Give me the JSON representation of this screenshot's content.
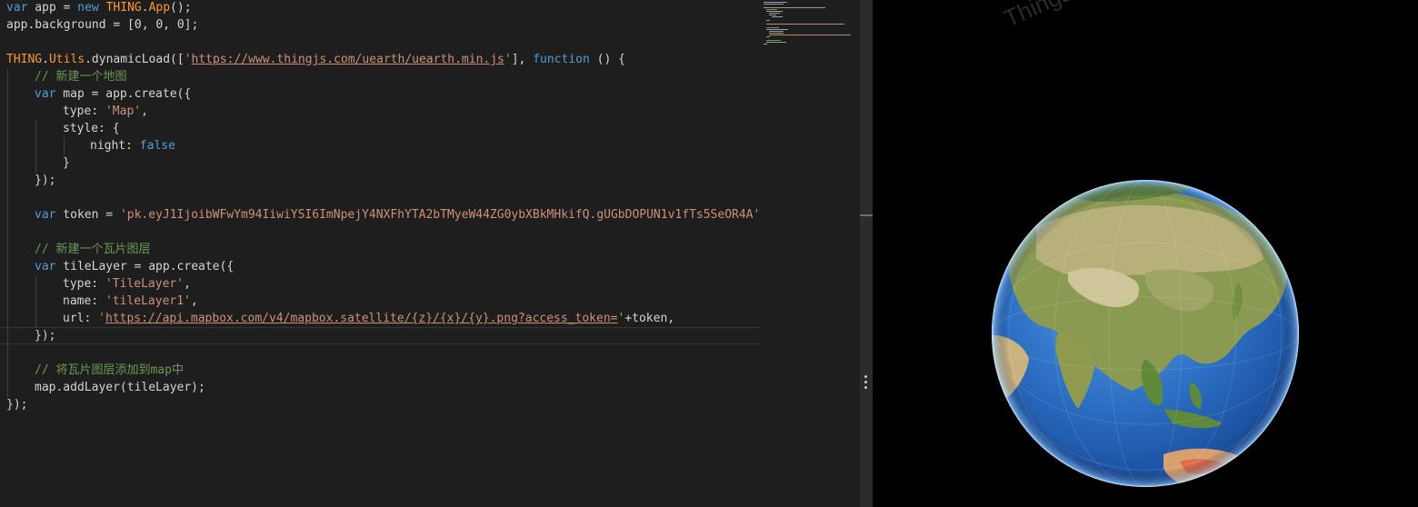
{
  "editor": {
    "lines": [
      {
        "parts": [
          [
            "kw",
            "var"
          ],
          [
            "",
            "  app = "
          ],
          [
            "kw",
            "new"
          ],
          [
            "",
            ""
          ],
          [
            "cls",
            " THING"
          ],
          [
            "",
            "."
          ],
          [
            "cls",
            "App"
          ],
          [
            "",
            "();"
          ]
        ]
      }
    ]
  },
  "code": {
    "l1": [
      "var",
      " app = ",
      "new",
      " ",
      "THING",
      ".",
      "App",
      "();"
    ],
    "l2": "app.background = [0, 0, 0];",
    "l4": [
      "THING",
      ".",
      "Utils",
      ".dynamicLoad([",
      "'",
      "https://www.thingjs.com/uearth/uearth.min.js",
      "'",
      "], ",
      "function",
      " () {"
    ],
    "l5": "// 新建一个地图",
    "l6": [
      "var",
      " map = app.create({"
    ],
    "l7": [
      "type: ",
      "'Map'",
      ","
    ],
    "l8": "style: {",
    "l9": [
      "night: ",
      "false"
    ],
    "l10": "}",
    "l11": "});",
    "l13": [
      "var",
      " token = ",
      "'pk.eyJ1IjoibWFwYm94IiwiYSI6ImNpejY4NXFhYTA2bTMyeW44ZG0ybXBkMHkifQ.gUGbDOPUN1v1fTs5SeOR4A'"
    ],
    "l15": "// 新建一个瓦片图层",
    "l16": [
      "var",
      " tileLayer = app.create({"
    ],
    "l17": [
      "type: ",
      "'TileLayer'",
      ","
    ],
    "l18": [
      "name: ",
      "'tileLayer1'",
      ","
    ],
    "l19": [
      "url: ",
      "'",
      "https://api.mapbox.com/v4/mapbox.satellite/{z}/{x}/{y}.png?access_token=",
      "'",
      "+token,"
    ],
    "l20": "});",
    "l22": "// 将瓦片图层添加到map中",
    "l23": "map.addLayer(tileLayer);",
    "l24": "});"
  },
  "viewport": {
    "watermark": "ThingJS by Ui"
  },
  "colors": {
    "editor_bg": "#1e1e1e",
    "keyword": "#569cd6",
    "class": "#f79a32",
    "string": "#ce9178",
    "comment": "#6a9955",
    "viewport_bg": "#000000"
  }
}
